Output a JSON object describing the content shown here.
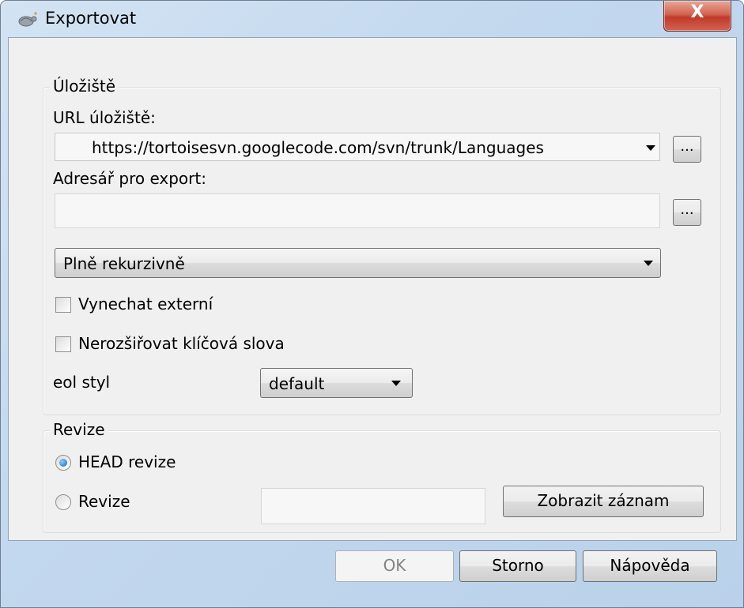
{
  "window": {
    "title": "Exportovat",
    "close_label": "X"
  },
  "repository": {
    "group_label": "Úložiště",
    "url_label": "URL úložiště:",
    "url_value": "https://tortoisesvn.googlecode.com/svn/trunk/Languages",
    "browse_label": "...",
    "export_dir_label": "Adresář pro export:",
    "export_dir_value": "",
    "depth_value": "Plně rekurzivně",
    "omit_externals_label": "Vynechat externí",
    "omit_externals_checked": false,
    "no_keywords_label": "Nerozšiřovat klíčová slova",
    "no_keywords_checked": false,
    "eol_label": "eol styl",
    "eol_value": "default"
  },
  "revision": {
    "group_label": "Revize",
    "head_label": "HEAD revize",
    "head_selected": true,
    "rev_label": "Revize",
    "rev_value": "",
    "show_log_label": "Zobrazit záznam"
  },
  "buttons": {
    "ok": "OK",
    "cancel": "Storno",
    "help": "Nápověda"
  },
  "icons": [
    "tortoise-icon",
    "close-icon",
    "dropdown-arrow-icon"
  ]
}
